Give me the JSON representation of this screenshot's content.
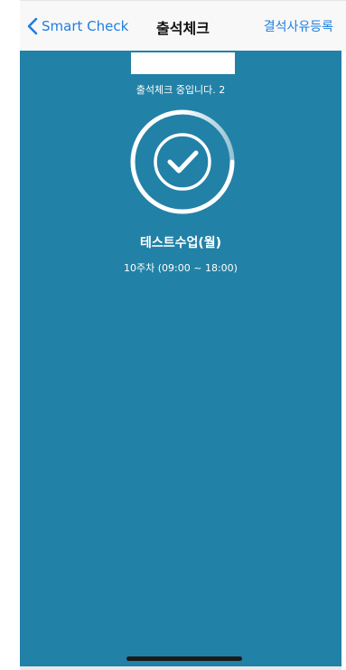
{
  "nav": {
    "back_label": "Smart Check",
    "title": "출석체크",
    "right_label": "결석사유등록"
  },
  "attendance": {
    "status_text": "출석체크 중입니다. 2",
    "course_name": "테스트수업(월)",
    "course_time": "10주차 (09:00 ~ 18:00)"
  },
  "colors": {
    "background": "#2281a6",
    "accent": "#1e7fe0",
    "nav_bg": "#f8f8f8"
  },
  "icons": {
    "back": "chevron-left-icon",
    "status": "check-circle-icon"
  }
}
